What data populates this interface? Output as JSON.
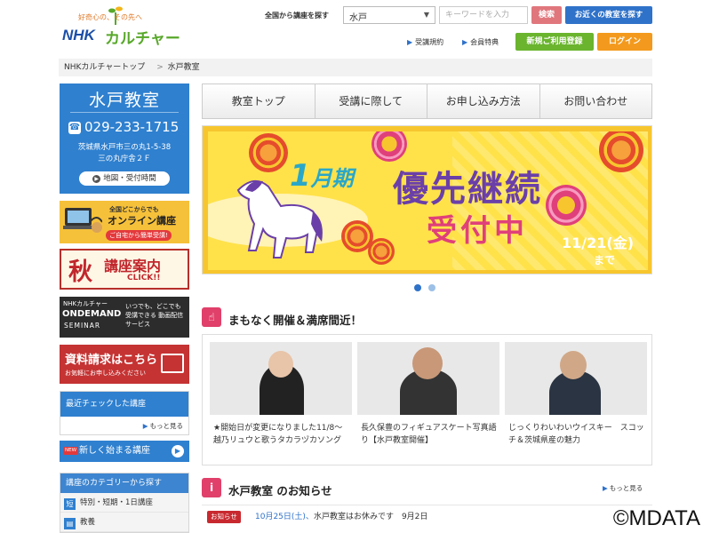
{
  "header": {
    "logo_tagline": "好奇心の、その先へ",
    "logo_nhk": "NHK",
    "logo_culture": "カルチャー",
    "search_label": "全国から講座を探す",
    "area_selected": "水戸",
    "keyword_placeholder": "キーワードを入力",
    "search_button": "検索",
    "near_button": "お近くの教室を探す",
    "link_terms": "受講規約",
    "link_member": "会員特典",
    "register_button": "新規ご利用登録",
    "login_button": "ログイン"
  },
  "breadcrumb": [
    "NHKカルチャートップ",
    "水戸教室"
  ],
  "breadcrumb_sep": ">",
  "classroom": {
    "name": "水戸教室",
    "phone": "029-233-1715",
    "address_line1": "茨城県水戸市三の丸1-5-38",
    "address_line2": "三の丸庁舎２Ｆ",
    "map_button": "地図・受付時間"
  },
  "banners": {
    "online_t1": "全国どこからでも",
    "online_t2": "オンライン講座",
    "online_t3": "ご自宅から簡単受講!",
    "guide_season": "秋",
    "guide_text": "講座案内",
    "guide_click": "CLICK!!",
    "od_t1": "NHKカルチャー",
    "od_t2": "ONDEMAND",
    "od_t3": "SEMINAR",
    "od_t4": "いつでも、どこでも 受講できる 動画配信サービス",
    "request_t1": "資料請求はこちら",
    "request_t2": "お気軽にお申し込みください"
  },
  "recent": {
    "title": "最近チェックした講座",
    "more": "もっと見る"
  },
  "new_courses": {
    "badge": "NEW",
    "label": "新しく始まる講座"
  },
  "categories": {
    "title": "講座のカテゴリーから探す",
    "items": [
      {
        "icon": "短",
        "label": "特別・短期・1日講座"
      },
      {
        "icon": "book-icon",
        "label": "教養"
      }
    ]
  },
  "nav": {
    "tabs": [
      "教室トップ",
      "受講に際して",
      "お申し込み方法",
      "お問い合わせ"
    ]
  },
  "hero": {
    "period_num": "1",
    "period_suffix": "月期",
    "title_line1": "優先継続",
    "title_line2": "受付中",
    "date_line1": "11/21(金)",
    "date_line2": "まで",
    "slide_count": 2,
    "active_slide": 1
  },
  "soon": {
    "heading": "まもなく開催＆満席間近！",
    "courses": [
      {
        "caption": "★開始日が変更になりました11/8～越乃リュウと歌うタカラヅカソング"
      },
      {
        "caption": "長久保豊のフィギュアスケート写真語り【水戸教室開催】"
      },
      {
        "caption": "じっくりわいわいウイスキー　スコッチ＆茨城県産の魅力"
      }
    ]
  },
  "notice": {
    "heading": "水戸教室 のお知らせ",
    "more": "もっと見る",
    "tag": "お知らせ",
    "date": "10月25日(土)、",
    "text": "水戸教室はお休みです　9月2日"
  },
  "watermark": "©MDATA",
  "colors": {
    "primary": "#2f80cf",
    "accent_red": "#c53333",
    "green": "#6ab42e",
    "orange": "#f39a1e"
  }
}
